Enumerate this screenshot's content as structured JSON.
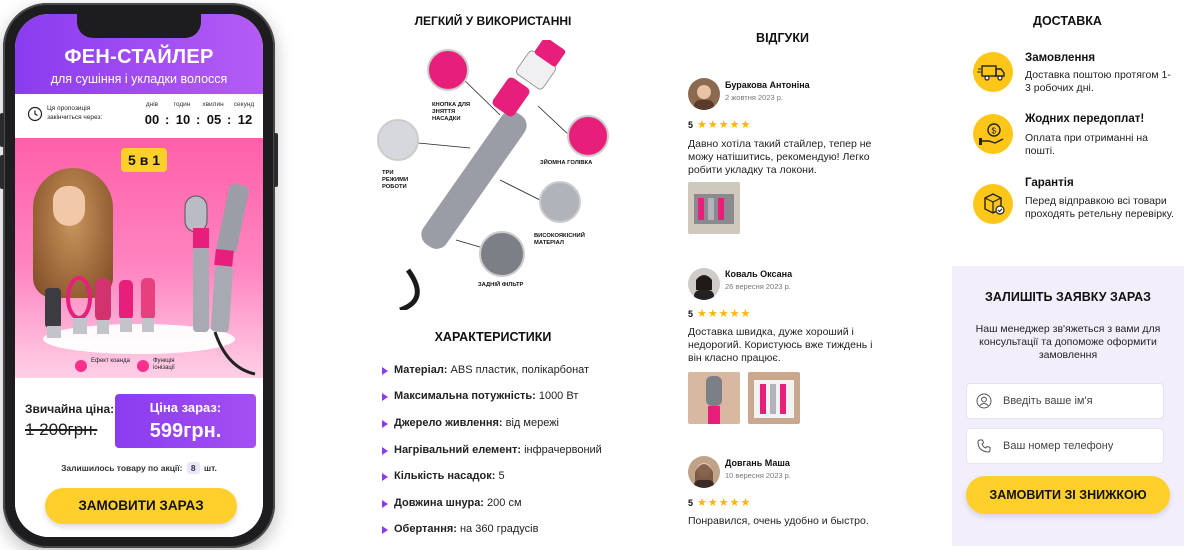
{
  "phone": {
    "hero_title": "ФЕН-СТАЙЛЕР",
    "hero_subtitle": "для сушіння і укладки волосся",
    "timer": {
      "label": "Ця пропозиція закінчиться через:",
      "units": [
        "днів",
        "годин",
        "хвилин",
        "секунд"
      ],
      "values": [
        "00",
        "10",
        "05",
        "12"
      ]
    },
    "badge": "5 в 1",
    "features": [
      "Ефект коанда",
      "Функція іонізації"
    ],
    "old_price_label": "Звичайна ціна:",
    "old_price": "1 200грн.",
    "new_price_label": "Ціна зараз:",
    "new_price": "599грн.",
    "stock_label": "Залишилось товару по акції:",
    "stock_count": "8",
    "stock_unit": "шт.",
    "order_button": "ЗАМОВИТИ ЗАРАЗ"
  },
  "features_section": {
    "title": "ЛЕГКИЙ У ВИКОРИСТАННІ",
    "labels": {
      "button": "КНОПКА ДЛЯ ЗНЯТТЯ НАСАДКИ",
      "modes": "ТРИ РЕЖИМИ РОБОТИ",
      "head": "ЗЙОМНА ГОЛІВКА",
      "material": "ВИСОКОЯКІСНИЙ МАТЕРІАЛ",
      "filter": "ЗАДНІЙ ФІЛЬТР"
    }
  },
  "specs": {
    "title": "ХАРАКТЕРИСТИКИ",
    "items": [
      {
        "name": "Матеріал:",
        "value": "ABS пластик, полікарбонат"
      },
      {
        "name": "Максимальна потужність:",
        "value": "1000 Вт"
      },
      {
        "name": "Джерело живлення:",
        "value": "від мережі"
      },
      {
        "name": "Нагрівальний елемент:",
        "value": "інфрачервоний"
      },
      {
        "name": "Кількість насадок:",
        "value": "5"
      },
      {
        "name": "Довжина шнура:",
        "value": "200 см"
      },
      {
        "name": "Обертання:",
        "value": "на 360 градусів"
      }
    ]
  },
  "reviews": {
    "title": "ВІДГУКИ",
    "items": [
      {
        "name": "Буракова Антоніна",
        "date": "2 жовтня 2023 р.",
        "rating": "5",
        "stars": "★★★★★",
        "text": "Давно хотіла такий стайлер, тепер не можу натішитись, рекомендую! Легко робити укладку та локони."
      },
      {
        "name": "Коваль Оксана",
        "date": "26 вересня 2023 р.",
        "rating": "5",
        "stars": "★★★★★",
        "text": "Доставка швидка, дуже хороший і недорогий. Користуюсь вже тиждень і він класно працює."
      },
      {
        "name": "Довгань Маша",
        "date": "10 вересня 2023 р.",
        "rating": "5",
        "stars": "★★★★★",
        "text": "Понравился, очень удобно и быстро."
      }
    ]
  },
  "delivery": {
    "title": "ДОСТАВКА",
    "items": [
      {
        "icon": "truck-icon",
        "title": "Замовлення",
        "text": "Доставка поштою протягом 1-3 робочих дні."
      },
      {
        "icon": "coin-hand-icon",
        "title": "Жодних передоплат!",
        "text": "Оплата при отриманні на пошті."
      },
      {
        "icon": "box-check-icon",
        "title": "Гарантія",
        "text": "Перед відправкою всі товари проходять ретельну перевірку."
      }
    ]
  },
  "form": {
    "title": "ЗАЛИШІТЬ ЗАЯВКУ ЗАРАЗ",
    "subtitle": "Наш менеджер зв'яжеться з вами для консультації та допоможе оформити замовлення",
    "name_placeholder": "Введіть ваше ім'я",
    "phone_placeholder": "Ваш номер телефону",
    "submit": "ЗАМОВИТИ ЗІ ЗНИЖКОЮ"
  },
  "colors": {
    "accent_purple": "#8a3cf0",
    "accent_pink": "#ff2f8e",
    "accent_yellow": "#ffd02b"
  }
}
